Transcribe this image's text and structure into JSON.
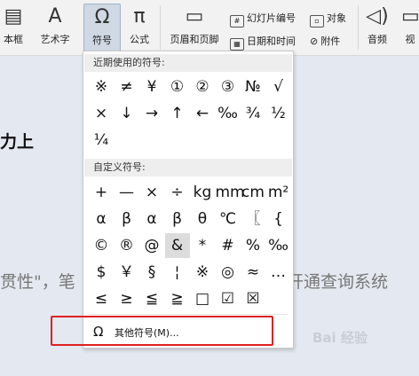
{
  "ribbon": {
    "items": [
      {
        "label": "本框",
        "icon": "▤"
      },
      {
        "label": "艺术字",
        "icon": "A"
      },
      {
        "label": "符号",
        "icon": "Ω"
      },
      {
        "label": "公式",
        "icon": "π"
      },
      {
        "label": "页眉和页脚",
        "icon": "▭"
      },
      {
        "label": "音频",
        "icon": "◁)"
      },
      {
        "label": "视",
        "icon": "▭"
      }
    ],
    "small": {
      "slide_number": "幻灯片编号",
      "object": "对象",
      "date_time": "日期和时间",
      "attachment": "附件"
    }
  },
  "document": {
    "heading_fragment": "力上",
    "line_left": "贯性\"，笔",
    "line_right": "开通查询系统",
    "watermark": "Bai 经验"
  },
  "symbol_menu": {
    "recent_title": "近期使用的符号:",
    "recent_symbols": [
      "※",
      "≠",
      "¥",
      "①",
      "②",
      "③",
      "№",
      "√",
      "×",
      "↓",
      "→",
      "↑",
      "←",
      "‰",
      "¾",
      "½",
      "¼"
    ],
    "custom_title": "自定义符号:",
    "custom_symbols": [
      "+",
      "—",
      "×",
      "÷",
      "kg",
      "mm",
      "cm",
      "m²",
      "α",
      "β",
      "α",
      "β",
      "θ",
      "℃",
      "〖",
      "{",
      "©",
      "®",
      "@",
      "&",
      "*",
      "#",
      "%",
      "‰",
      "$",
      "￥",
      "§",
      "¦",
      "※",
      "◎",
      "≈",
      "…",
      "≤",
      "≥",
      "≦",
      "≧",
      "□",
      "☑",
      "☒"
    ],
    "highlighted_symbol": "&",
    "other_symbols_label": "其他符号(M)...",
    "other_icon": "Ω"
  },
  "colors": {
    "highlight_box": "#e02020",
    "ribbon_bg": "#f2f2f2",
    "doc_bg": "#e4e9f1"
  }
}
